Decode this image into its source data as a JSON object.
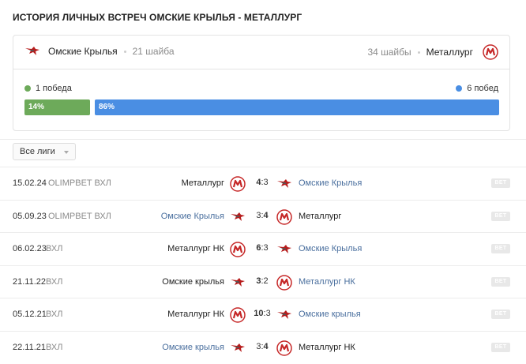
{
  "title": "ИСТОРИЯ ЛИЧНЫХ ВСТРЕЧ ОМСКИЕ КРЫЛЬЯ - МЕТАЛЛУРГ",
  "summary": {
    "team_left": "Омские Крылья",
    "goals_left": "21 шайба",
    "goals_right": "34 шайбы",
    "team_right": "Металлург",
    "wins_left": "1 победа",
    "wins_right": "6 побед",
    "pct_left": "14%",
    "pct_right": "86%",
    "pct_left_value": 14,
    "color_left": "#6daa5a",
    "color_right": "#4a8ee3"
  },
  "filter": {
    "label": "Все лиги"
  },
  "matches": [
    {
      "date": "15.02.24",
      "league": "OLIMPBET ВХЛ",
      "home": "Металлург",
      "home_logo": "metallurg-logo",
      "score_home": "4",
      "score_away": "3",
      "away": "Омские Крылья",
      "away_logo": "hawk-logo",
      "winner": "home",
      "bet": "BET"
    },
    {
      "date": "05.09.23",
      "league": "OLIMPBET ВХЛ",
      "home": "Омские Крылья",
      "home_logo": "hawk-logo",
      "score_home": "3",
      "score_away": "4",
      "away": "Металлург",
      "away_logo": "metallurg-logo",
      "winner": "away",
      "bet": "BET"
    },
    {
      "date": "06.02.23",
      "league": "ВХЛ",
      "home": "Металлург НК",
      "home_logo": "metallurg-logo",
      "score_home": "6",
      "score_away": "3",
      "away": "Омские Крылья",
      "away_logo": "hawk-logo",
      "winner": "home",
      "bet": "BET"
    },
    {
      "date": "21.11.22",
      "league": "ВХЛ",
      "home": "Омские крылья",
      "home_logo": "hawk-logo",
      "score_home": "3",
      "score_away": "2",
      "away": "Металлург НК",
      "away_logo": "metallurg-logo",
      "winner": "home",
      "bet": "BET"
    },
    {
      "date": "05.12.21",
      "league": "ВХЛ",
      "home": "Металлург НК",
      "home_logo": "metallurg-logo",
      "score_home": "10",
      "score_away": "3",
      "away": "Омские крылья",
      "away_logo": "hawk-logo",
      "winner": "home",
      "bet": "BET"
    },
    {
      "date": "22.11.21",
      "league": "ВХЛ",
      "home": "Омские крылья",
      "home_logo": "hawk-logo",
      "score_home": "3",
      "score_away": "4",
      "away": "Металлург НК",
      "away_logo": "metallurg-logo",
      "winner": "away",
      "bet": "BET"
    }
  ]
}
